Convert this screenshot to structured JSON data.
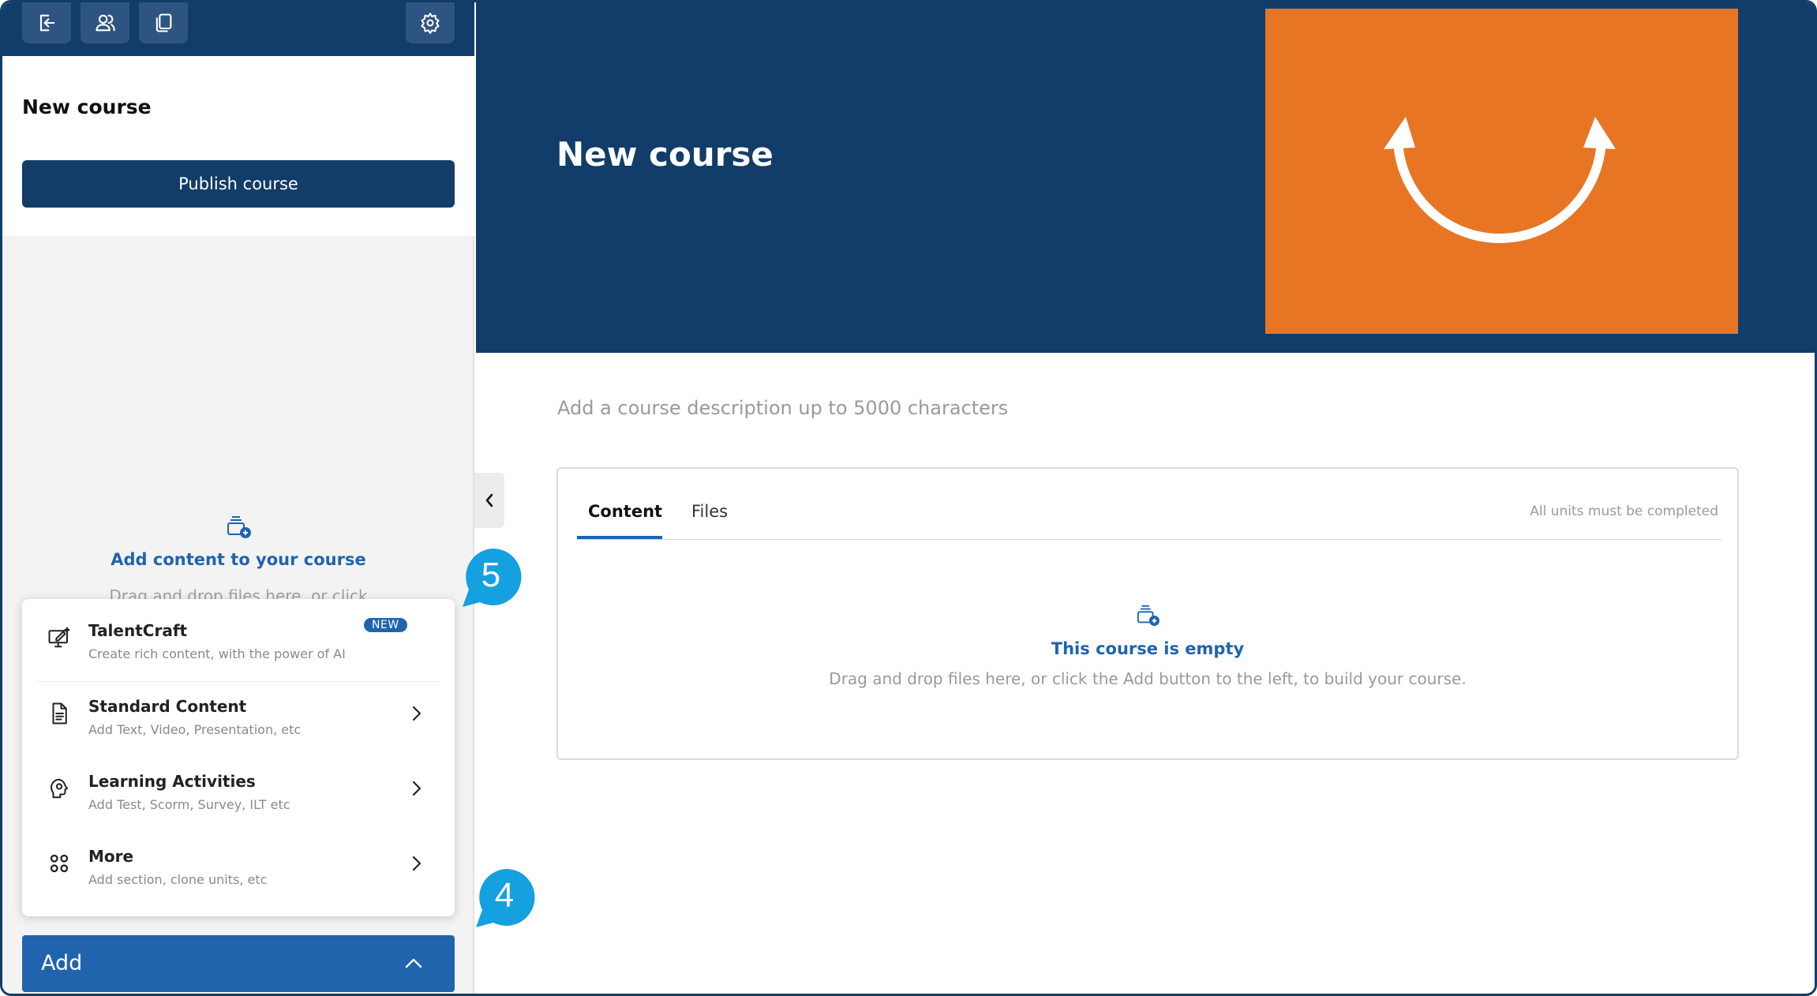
{
  "sidebar": {
    "top_icons": [
      "exit-icon",
      "users-icon",
      "copy-icon",
      "settings-icon"
    ],
    "course_title": "New course",
    "publish_label": "Publish course",
    "empty": {
      "icon": "add-content-icon",
      "title": "Add content to your course",
      "hint": "Drag and drop files here, or click"
    },
    "add_menu": {
      "items": [
        {
          "icon": "ai-edit-icon",
          "title": "TalentCraft",
          "subtitle": "Create rich content, with the power of AI",
          "badge": "NEW"
        },
        {
          "icon": "document-icon",
          "title": "Standard Content",
          "subtitle": "Add Text, Video, Presentation, etc"
        },
        {
          "icon": "learning-activity-icon",
          "title": "Learning Activities",
          "subtitle": "Add Test, Scorm, Survey, ILT etc"
        },
        {
          "icon": "more-grid-icon",
          "title": "More",
          "subtitle": "Add section, clone units, etc"
        }
      ]
    },
    "add_button": "Add"
  },
  "main": {
    "hero": {
      "title": "New course",
      "image_color": "#e87524"
    },
    "description_placeholder": "Add a course description up to 5000 characters",
    "tabs": [
      {
        "label": "Content",
        "active": true
      },
      {
        "label": "Files",
        "active": false
      }
    ],
    "completion_note": "All units must be completed",
    "empty": {
      "title": "This course is empty",
      "hint": "Drag and drop files here, or click the Add button to the left, to build your course."
    }
  },
  "callouts": [
    "5",
    "4"
  ],
  "colors": {
    "navy": "#123c69",
    "accent_blue": "#1f64ad",
    "orange": "#e87524",
    "callout": "#15a0e0"
  }
}
